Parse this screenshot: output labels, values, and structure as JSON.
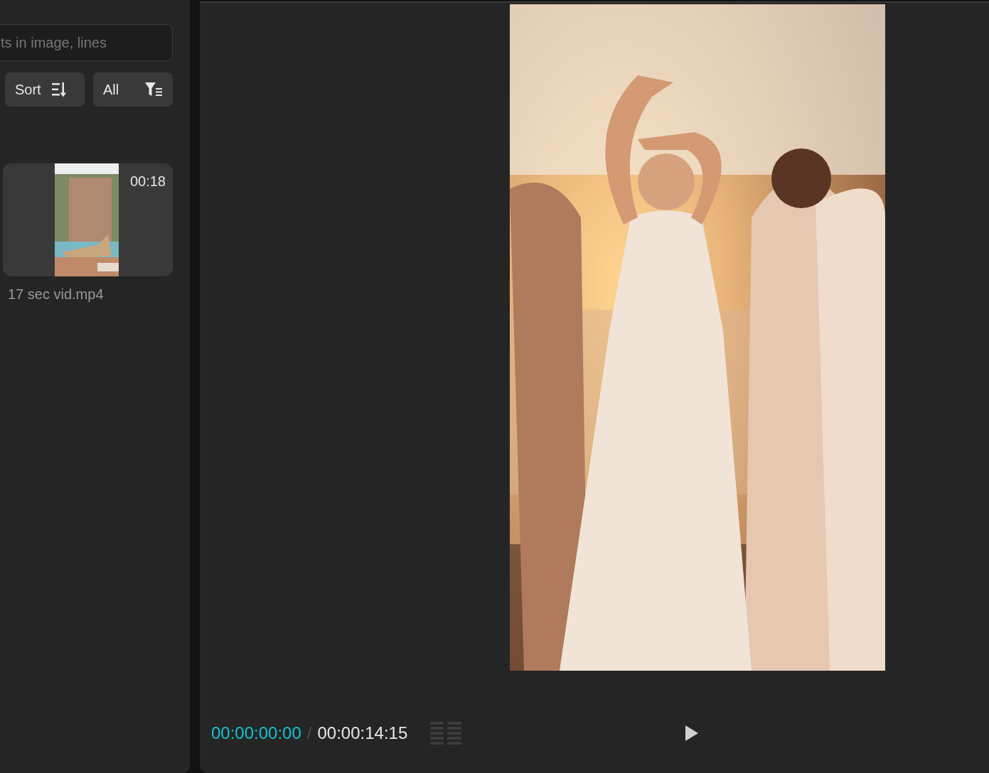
{
  "media_panel": {
    "search": {
      "placeholder": "ts in image, lines"
    },
    "sort_button": "Sort",
    "filter_button": "All",
    "clips": [
      {
        "duration": "00:18",
        "filename": "17 sec vid.mp4"
      }
    ]
  },
  "player": {
    "current_time": "00:00:00:00",
    "separator": "/",
    "total_time": "00:00:14:15"
  }
}
